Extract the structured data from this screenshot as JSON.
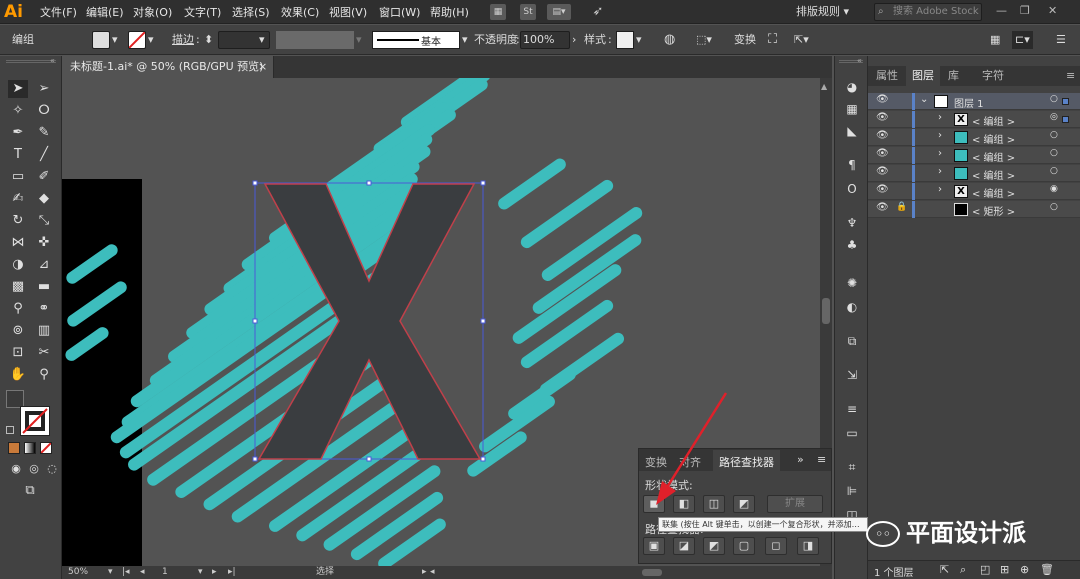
{
  "app": {
    "logo": "Ai"
  },
  "menu": [
    "文件(F)",
    "编辑(E)",
    "对象(O)",
    "文字(T)",
    "选择(S)",
    "效果(C)",
    "视图(V)",
    "窗口(W)",
    "帮助(H)"
  ],
  "menubar": {
    "st_badge": "St",
    "arrange_label": "排版规则",
    "search_placeholder": "搜索 Adobe Stock"
  },
  "controlbar": {
    "selection_label": "编组",
    "stroke_label": "描边",
    "stroke_colon": ":",
    "stroke_profile": "基本",
    "opacity_label": "不透明度",
    "opacity_value": "100%",
    "style_label": "样式",
    "transform_label": "变换"
  },
  "document": {
    "tab_title": "未标题-1.ai* @ 50% (RGB/GPU 预览)",
    "tab_close": "×"
  },
  "statusbar": {
    "zoom": "50%",
    "artboard": "1",
    "tool_status": "选择"
  },
  "panel_tabs": [
    "属性",
    "图层",
    "库",
    "字符"
  ],
  "layers": {
    "rows": [
      {
        "name": "图层 1",
        "level": 0
      },
      {
        "name": "< 编组 >",
        "level": 1
      },
      {
        "name": "< 编组 >",
        "level": 1
      },
      {
        "name": "< 编组 >",
        "level": 1
      },
      {
        "name": "< 编组 >",
        "level": 1
      },
      {
        "name": "< 编组 >",
        "level": 1
      },
      {
        "name": "< 矩形 >",
        "level": 1
      }
    ],
    "footer_count": "1 个图层",
    "accent_color": "#5a82c8"
  },
  "pathfinder": {
    "tabs": [
      "变换",
      "对齐",
      "路径查找器"
    ],
    "shape_modes_label": "形状模式:",
    "pathfinders_label": "路径查找器:",
    "expand_button": "扩展",
    "tooltip": "联集 (按住 Alt 键单击，以创建一个复合形状，并添加…"
  },
  "artwork": {
    "letter": "X",
    "teal": "#3dbdbd",
    "letter_fill": "#3a3d40",
    "outline": "#c0404a"
  },
  "watermark": "平面设计派",
  "colors": {
    "menubar": "#2f2f2f",
    "panel": "#424242",
    "canvas": "#535353"
  }
}
